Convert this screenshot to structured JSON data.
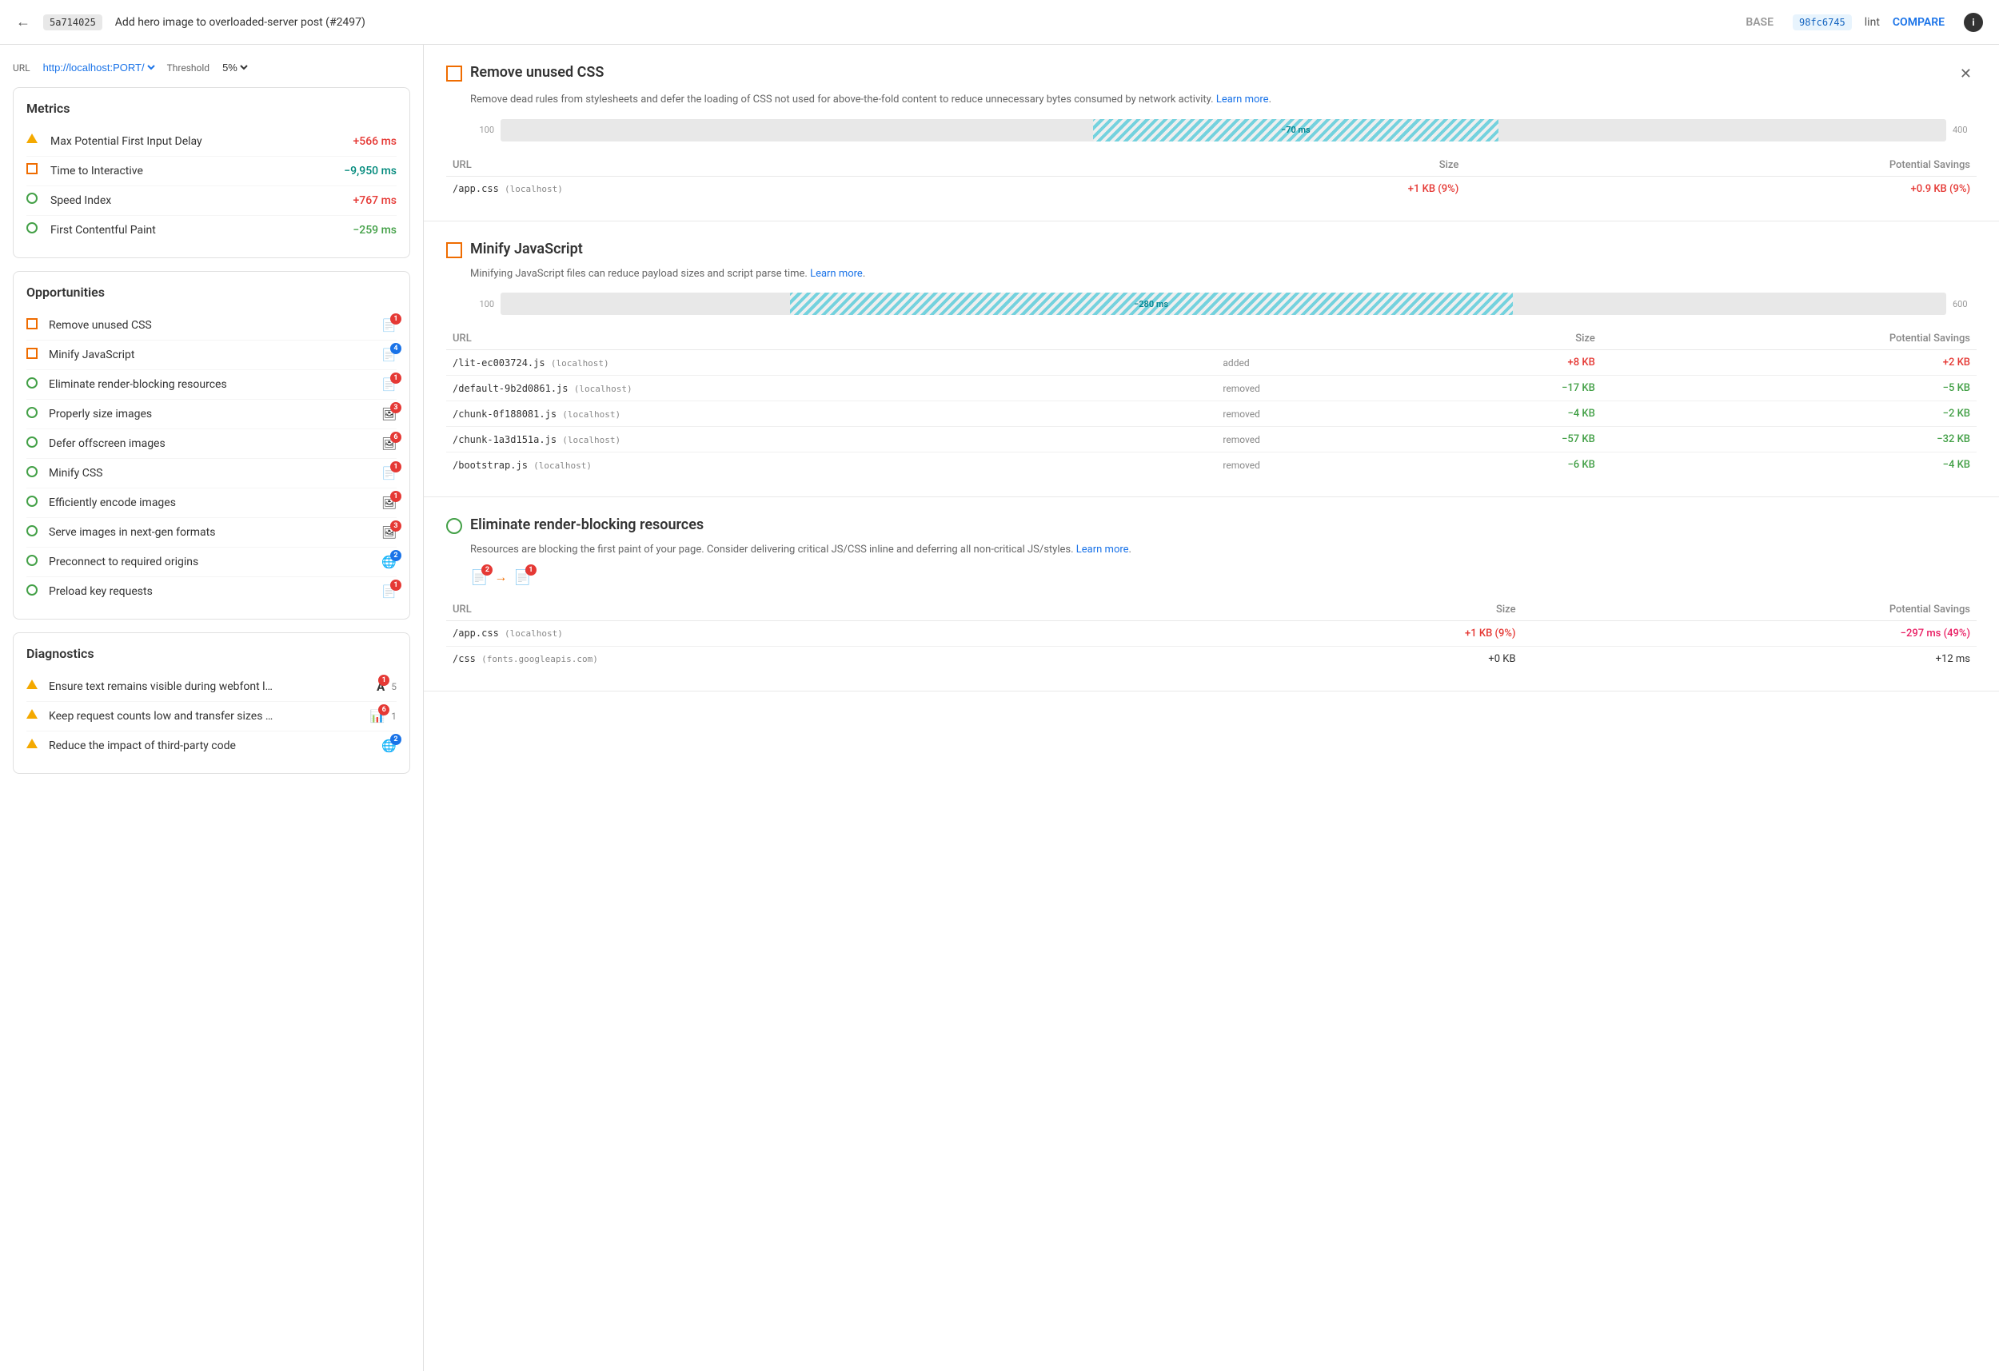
{
  "header": {
    "back_label": "←",
    "commit_base": "5a714025",
    "commit_title": "Add hero image to overloaded-server post (#2497)",
    "tab_base": "BASE",
    "commit_lint": "98fc6745",
    "tab_lint": "lint",
    "compare_label": "COMPARE",
    "info_label": "i"
  },
  "left": {
    "url_label": "URL",
    "url_value": "http://localhost:PORT/",
    "threshold_label": "Threshold",
    "threshold_value": "5%",
    "metrics_title": "Metrics",
    "metrics": [
      {
        "icon": "triangle",
        "name": "Max Potential First Input Delay",
        "value": "+566 ms",
        "color": "red"
      },
      {
        "icon": "square-orange",
        "name": "Time to Interactive",
        "value": "−9,950 ms",
        "color": "cyan"
      },
      {
        "icon": "circle-green",
        "name": "Speed Index",
        "value": "+767 ms",
        "color": "red"
      },
      {
        "icon": "circle-green",
        "name": "First Contentful Paint",
        "value": "−259 ms",
        "color": "green"
      }
    ],
    "opportunities_title": "Opportunities",
    "opportunities": [
      {
        "icon": "square-orange",
        "name": "Remove unused CSS",
        "badges": [
          {
            "icon": "file",
            "count": "1",
            "color": "red"
          }
        ]
      },
      {
        "icon": "square-orange",
        "name": "Minify JavaScript",
        "badges": [
          {
            "icon": "file",
            "count": "4",
            "color": "blue"
          }
        ]
      },
      {
        "icon": "circle-green",
        "name": "Eliminate render-blocking resources",
        "badges": [
          {
            "icon": "file",
            "count": "1",
            "color": "red"
          }
        ]
      },
      {
        "icon": "circle-green",
        "name": "Properly size images",
        "badges": [
          {
            "icon": "img",
            "count": "3",
            "color": "red"
          }
        ]
      },
      {
        "icon": "circle-green",
        "name": "Defer offscreen images",
        "badges": [
          {
            "icon": "img",
            "count": "6",
            "color": "red"
          }
        ]
      },
      {
        "icon": "circle-green",
        "name": "Minify CSS",
        "badges": [
          {
            "icon": "file",
            "count": "1",
            "color": "red"
          }
        ]
      },
      {
        "icon": "circle-green",
        "name": "Efficiently encode images",
        "badges": [
          {
            "icon": "img",
            "count": "1",
            "color": "red"
          }
        ]
      },
      {
        "icon": "circle-green",
        "name": "Serve images in next-gen formats",
        "badges": [
          {
            "icon": "img",
            "count": "3",
            "color": "red"
          }
        ]
      },
      {
        "icon": "circle-green",
        "name": "Preconnect to required origins",
        "badges": [
          {
            "icon": "globe",
            "count": "2",
            "color": "blue"
          }
        ]
      },
      {
        "icon": "circle-green",
        "name": "Preload key requests",
        "badges": [
          {
            "icon": "file",
            "count": "1",
            "color": "red"
          }
        ]
      }
    ],
    "diagnostics_title": "Diagnostics",
    "diagnostics": [
      {
        "icon": "triangle",
        "name": "Ensure text remains visible during webfont l…",
        "badges": [
          {
            "icon": "A",
            "count": "1",
            "color": "red"
          },
          {
            "extra": "5",
            "color": "red"
          }
        ]
      },
      {
        "icon": "triangle",
        "name": "Keep request counts low and transfer sizes …",
        "badges": [
          {
            "icon": "table",
            "count": "6",
            "color": "red"
          },
          {
            "extra": "1",
            "color": "red"
          }
        ]
      },
      {
        "icon": "triangle",
        "name": "Reduce the impact of third-party code",
        "badges": [
          {
            "icon": "globe",
            "count": "2",
            "color": "blue"
          }
        ]
      }
    ]
  },
  "right": {
    "sections": [
      {
        "id": "remove-unused-css",
        "icon": "square-orange",
        "title": "Remove unused CSS",
        "description": "Remove dead rules from stylesheets and defer the loading of CSS not used for above-the-fold content to reduce unnecessary bytes consumed by network activity.",
        "learn_more": "Learn more",
        "chart": {
          "start_label": "100",
          "end_label": "400",
          "bar_start_pct": 42,
          "bar_width_pct": 28,
          "bar_label": "−70 ms"
        },
        "table": {
          "headers": [
            "URL",
            "Size",
            "Potential Savings"
          ],
          "rows": [
            {
              "url": "/app.css",
              "host": "(localhost)",
              "status": "",
              "size": "+1 KB (9%)",
              "size_color": "red",
              "savings": "+0.9 KB (9%)",
              "savings_color": "red"
            }
          ]
        }
      },
      {
        "id": "minify-javascript",
        "icon": "square-orange",
        "title": "Minify JavaScript",
        "description": "Minifying JavaScript files can reduce payload sizes and script parse time.",
        "learn_more": "Learn more",
        "chart": {
          "start_label": "100",
          "end_label": "600",
          "bar_start_pct": 22,
          "bar_width_pct": 48,
          "bar_label": "−280 ms"
        },
        "table": {
          "headers": [
            "URL",
            "Size",
            "Potential Savings"
          ],
          "rows": [
            {
              "url": "/lit-ec003724.js",
              "host": "(localhost)",
              "status": "added",
              "size": "+8 KB",
              "size_color": "red",
              "savings": "+2 KB",
              "savings_color": "red"
            },
            {
              "url": "/default-9b2d0861.js",
              "host": "(localhost)",
              "status": "removed",
              "size": "−17 KB",
              "size_color": "green",
              "savings": "−5 KB",
              "savings_color": "green"
            },
            {
              "url": "/chunk-0f188081.js",
              "host": "(localhost)",
              "status": "removed",
              "size": "−4 KB",
              "size_color": "green",
              "savings": "−2 KB",
              "savings_color": "green"
            },
            {
              "url": "/chunk-1a3d151a.js",
              "host": "(localhost)",
              "status": "removed",
              "size": "−57 KB",
              "size_color": "green",
              "savings": "−32 KB",
              "savings_color": "green"
            },
            {
              "url": "/bootstrap.js",
              "host": "(localhost)",
              "status": "removed",
              "size": "−6 KB",
              "size_color": "green",
              "savings": "−4 KB",
              "savings_color": "green"
            }
          ]
        }
      },
      {
        "id": "eliminate-render-blocking",
        "icon": "circle-green",
        "title": "Eliminate render-blocking resources",
        "description": "Resources are blocking the first paint of your page. Consider delivering critical JS/CSS inline and deferring all non-critical JS/styles.",
        "learn_more": "Learn more",
        "has_elim_icons": true,
        "table": {
          "headers": [
            "URL",
            "Size",
            "Potential Savings"
          ],
          "rows": [
            {
              "url": "/app.css",
              "host": "(localhost)",
              "status": "",
              "size": "+1 KB (9%)",
              "size_color": "red",
              "savings": "−297 ms (49%)",
              "savings_color": "cyan-pink"
            },
            {
              "url": "/css",
              "host": "(fonts.googleapis.com)",
              "status": "",
              "size": "+0 KB",
              "size_color": "normal",
              "savings": "+12 ms",
              "savings_color": "normal"
            }
          ]
        }
      }
    ]
  }
}
